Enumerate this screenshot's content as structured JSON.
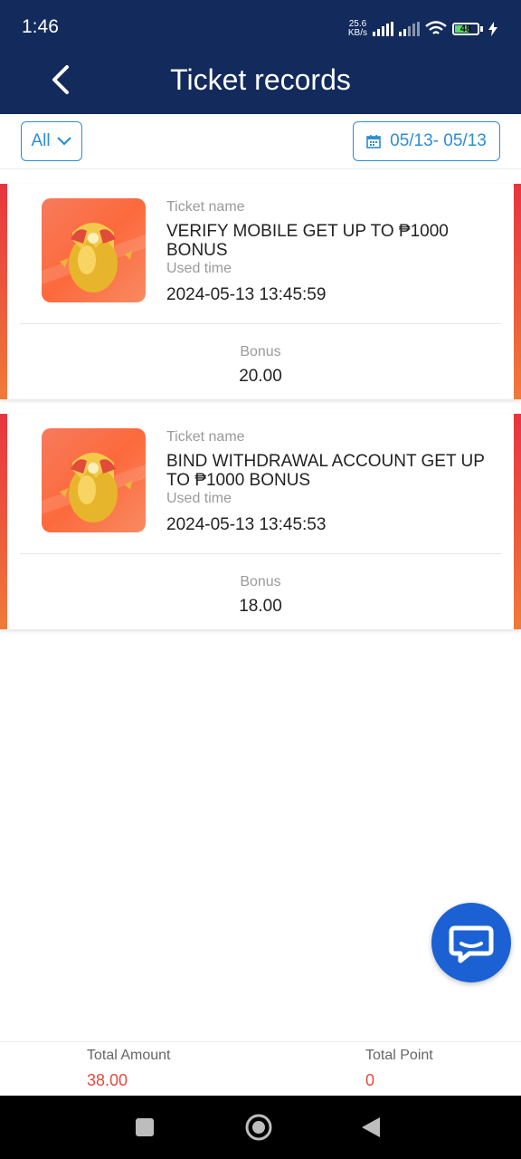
{
  "status": {
    "time": "1:46",
    "net_speed_value": "25.6",
    "net_speed_unit": "KB/s",
    "battery": "48"
  },
  "header": {
    "title": "Ticket records"
  },
  "filter": {
    "type_selected": "All",
    "date_range": "05/13- 05/13"
  },
  "records": [
    {
      "name_label": "Ticket name",
      "name": "VERIFY MOBILE GET UP TO ₱1000 BONUS",
      "time_label": "Used time",
      "time": "2024-05-13 13:45:59",
      "bonus_label": "Bonus",
      "bonus": "20.00"
    },
    {
      "name_label": "Ticket name",
      "name": "BIND WITHDRAWAL ACCOUNT GET UP TO ₱1000 BONUS",
      "time_label": "Used time",
      "time": "2024-05-13 13:45:53",
      "bonus_label": "Bonus",
      "bonus": "18.00"
    }
  ],
  "totals": {
    "amount_label": "Total Amount",
    "amount": "38.00",
    "point_label": "Total Point",
    "point": "0"
  },
  "colors": {
    "header_bg": "#132a5c",
    "accent": "#2b8ed6",
    "total_value": "#e04b3e",
    "chat_fab": "#1b61d4"
  },
  "icons": [
    "back-arrow-icon",
    "chevron-down-icon",
    "calendar-icon",
    "golden-egg-icon",
    "chat-icon",
    "square-nav-icon",
    "home-nav-icon",
    "back-nav-icon"
  ]
}
